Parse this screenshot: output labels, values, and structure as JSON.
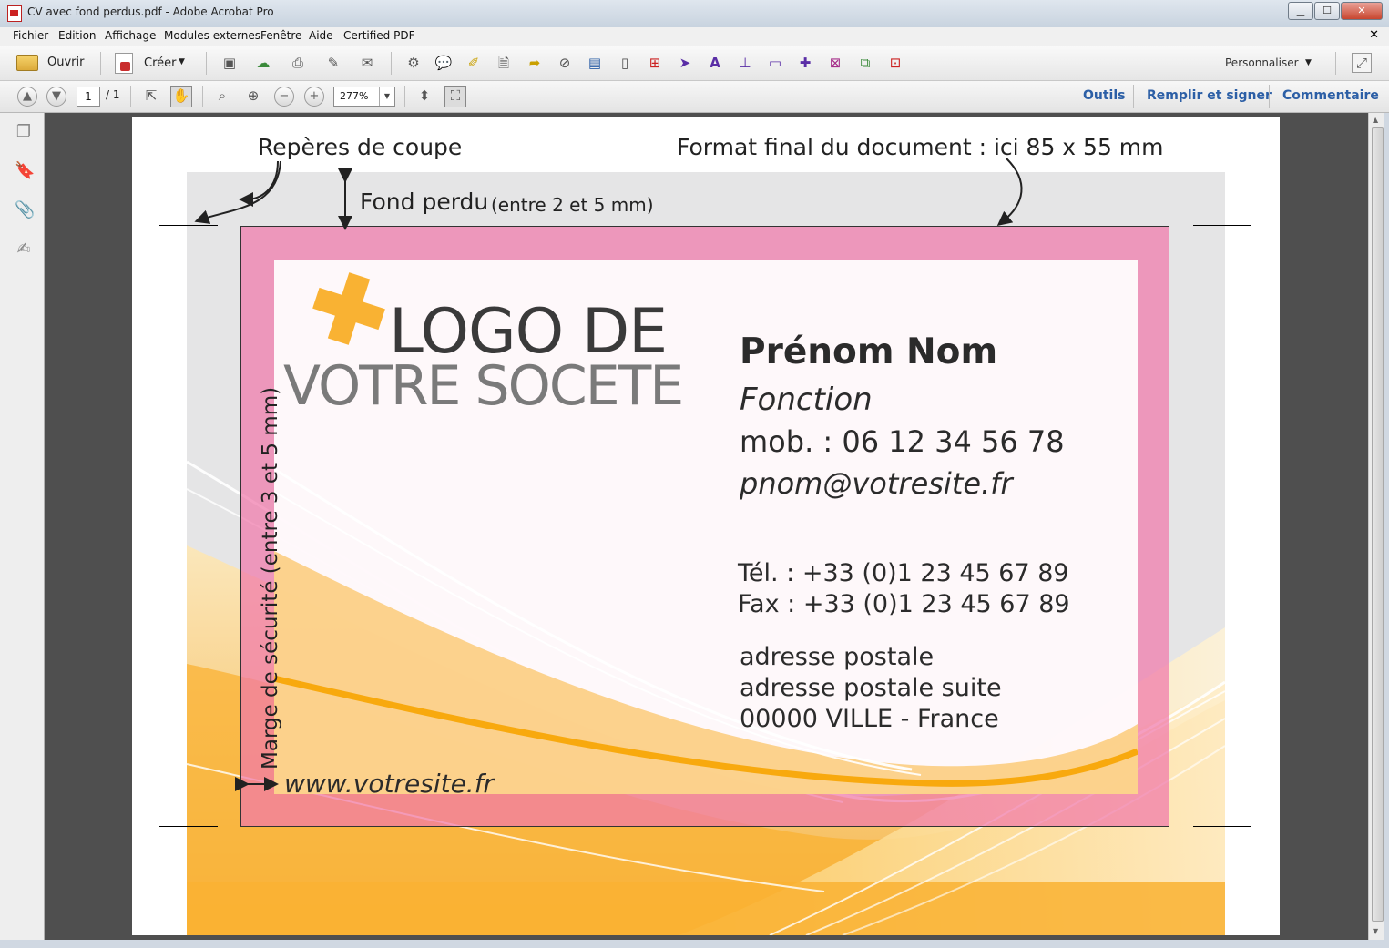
{
  "window": {
    "title": "CV avec fond perdus.pdf - Adobe Acrobat Pro",
    "minimize": "▁",
    "maximize": "☐",
    "close": "✕"
  },
  "menu": {
    "items": [
      "Fichier",
      "Edition",
      "Affichage",
      "Modules externes",
      "Fenêtre",
      "Aide",
      "Certified PDF"
    ],
    "close": "✕"
  },
  "toolbar": {
    "open_label": "Ouvrir",
    "create_label": "Créer",
    "customize_label": "Personnaliser"
  },
  "nav": {
    "page_current": "1",
    "page_total": "/ 1",
    "zoom": "277%"
  },
  "panels": {
    "tools": "Outils",
    "fill_sign": "Remplir et signer",
    "comment": "Commentaire"
  },
  "document": {
    "annotations": {
      "crop_marks": "Repères de coupe",
      "final_format": "Format final du document : ici 85 x 55 mm",
      "bleed": "Fond perdu",
      "bleed_range": "(entre 2 et 5 mm)",
      "safety_margin": "Marge de sécurité (entre 3 et 5 mm)"
    },
    "card": {
      "logo_line1": "LOGO DE",
      "logo_line2": "VOTRE SOCETE",
      "name": "Prénom Nom",
      "function": "Fonction",
      "mobile": "mob. : 06 12 34 56 78",
      "email": "pnom@votresite.fr",
      "phone": "Tél. :  +33 (0)1 23 45 67 89",
      "fax": "Fax :  +33 (0)1 23 45 67 89",
      "address1": "adresse postale",
      "address2": "adresse postale suite",
      "address3": "00000 VILLE - France",
      "website": "www.votresite.fr"
    }
  },
  "colors": {
    "bleed_pink": "#f07aab",
    "accent_orange": "#f9b233",
    "bleed_gray": "#e5e5e6",
    "link_blue": "#2c5fa6"
  }
}
